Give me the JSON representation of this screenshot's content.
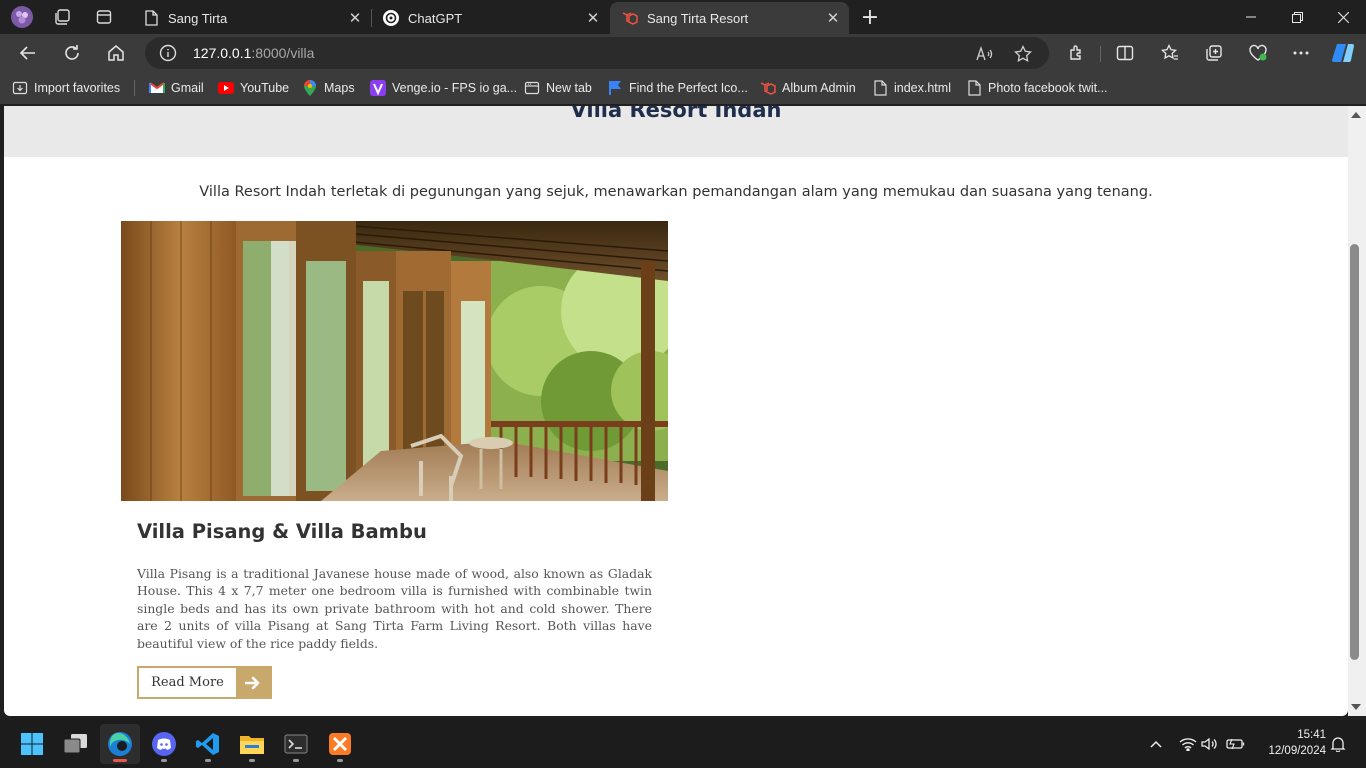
{
  "browser": {
    "tabs": [
      {
        "title": "Sang Tirta",
        "icon": "page-icon",
        "active": false
      },
      {
        "title": "ChatGPT",
        "icon": "chatgpt-icon",
        "active": false
      },
      {
        "title": "Sang Tirta Resort",
        "icon": "laravel-icon",
        "active": true
      }
    ],
    "tab_close_glyph": "✕",
    "new_tab_glyph": "+",
    "address": {
      "host": "127.0.0.1",
      "path": ":8000/villa"
    },
    "bookmarks": [
      {
        "label": "Import favorites",
        "icon": "import-icon"
      },
      {
        "label": "Gmail",
        "icon": "gmail-icon"
      },
      {
        "label": "YouTube",
        "icon": "youtube-icon"
      },
      {
        "label": "Maps",
        "icon": "maps-icon"
      },
      {
        "label": "Venge.io - FPS io ga...",
        "icon": "venge-icon"
      },
      {
        "label": "New tab",
        "icon": "newtab-icon"
      },
      {
        "label": "Find the Perfect Ico...",
        "icon": "flag-icon"
      },
      {
        "label": "Album Admin",
        "icon": "laravel-icon"
      },
      {
        "label": "index.html",
        "icon": "file-icon"
      },
      {
        "label": "Photo facebook twit...",
        "icon": "file-icon"
      }
    ]
  },
  "page": {
    "hero_title": "Villa Resort Indah",
    "intro": "Villa Resort Indah terletak di pegunungan yang sejuk, menawarkan pemandangan alam yang memukau dan suasana yang tenang.",
    "card": {
      "title": "Villa Pisang & Villa Bambu",
      "text": "Villa Pisang is a traditional Javanese house made of wood, also known as Gladak House. This 4 x 7,7 meter one bedroom villa is furnished with combinable twin single beds and has its own private bathroom with hot and cold shower. There are 2 units of villa Pisang at Sang Tirta Farm Living Resort. Both villas have beautiful view of the rice paddy fields.",
      "button": "Read More"
    },
    "accent_color": "#c9a96b",
    "title_color": "#1f2e4a"
  },
  "taskbar": {
    "apps": [
      "windows-start-icon",
      "task-view-icon",
      "edge-icon",
      "discord-icon",
      "vscode-icon",
      "file-explorer-icon",
      "terminal-icon",
      "xampp-icon"
    ],
    "time": "15:41",
    "date": "12/09/2024"
  }
}
